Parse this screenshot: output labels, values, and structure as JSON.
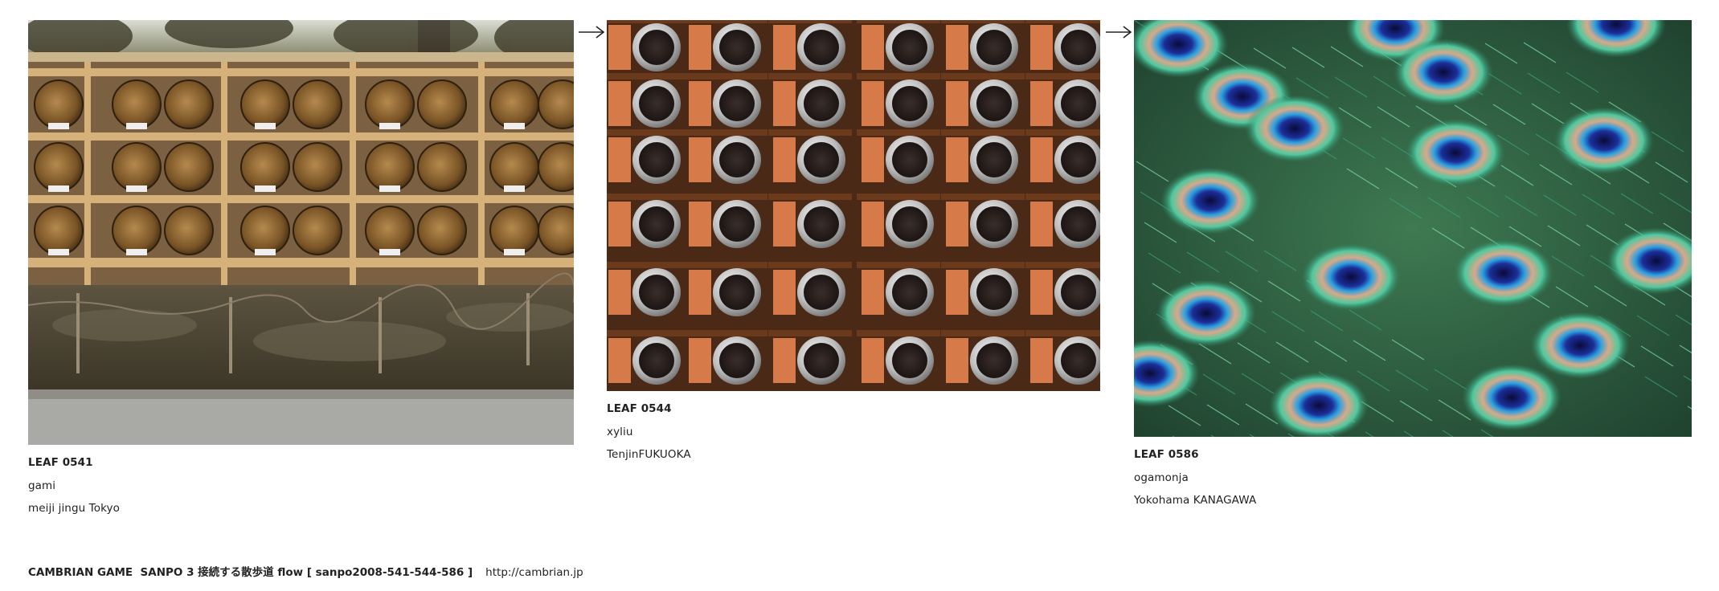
{
  "leaves": [
    {
      "leaf_id": "LEAF 0541",
      "author": "gami",
      "location": "meiji jingu Tokyo",
      "photo_icon": "barrels-photo"
    },
    {
      "leaf_id": "LEAF 0544",
      "author": "xyliu",
      "location": "TenjinFUKUOKA",
      "photo_icon": "tea-tins-photo"
    },
    {
      "leaf_id": "LEAF 0586",
      "author": "ogamonja",
      "location": "Yokohama KANAGAWA",
      "photo_icon": "peacock-feathers-photo"
    }
  ],
  "arrows": [
    "right-arrow-icon",
    "right-arrow-icon"
  ],
  "footer": {
    "text": "CAMBRIAN GAME  SANPO 3 接続する散歩道 flow [ sanpo2008-541-544-586 ]",
    "url": "http://cambrian.jp"
  },
  "colors": {
    "text": "#222222",
    "background": "#ffffff"
  }
}
